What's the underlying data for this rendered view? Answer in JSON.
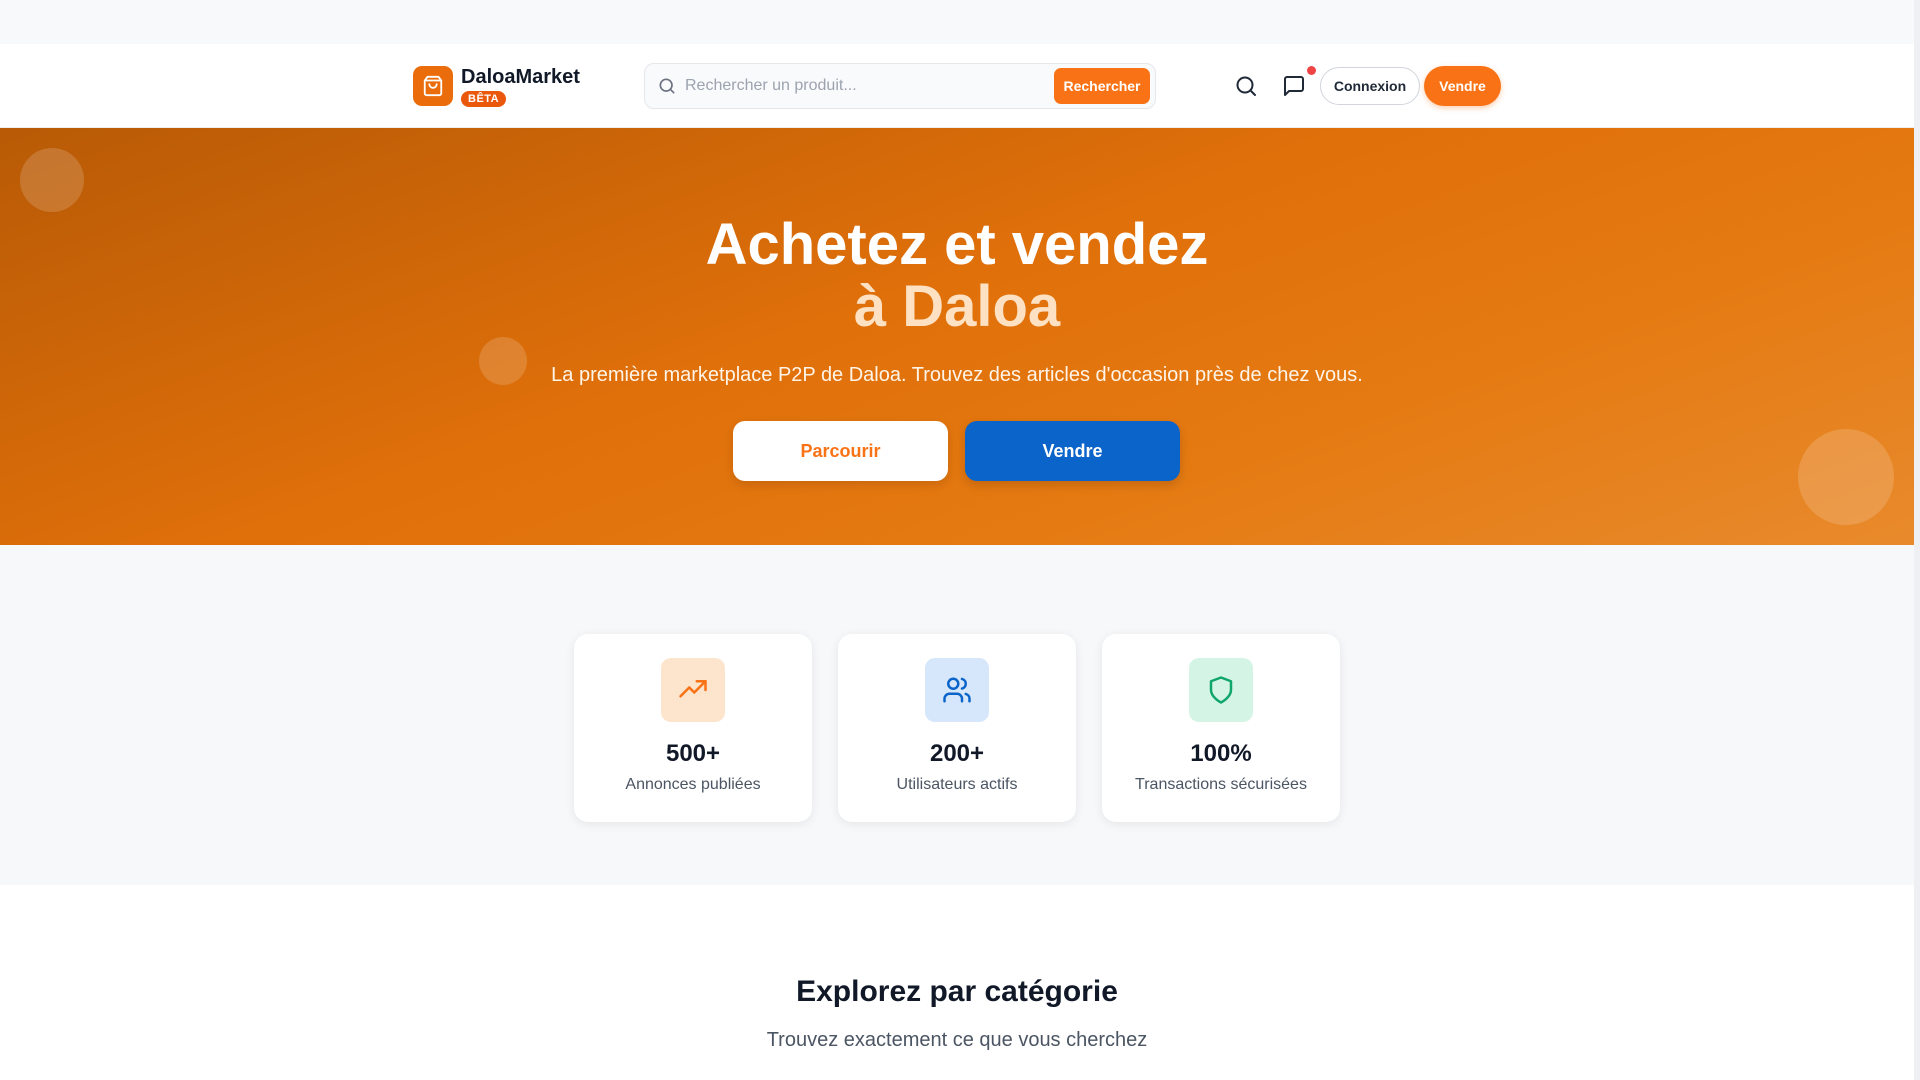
{
  "header": {
    "brand": "DaloaMarket",
    "badge": "BÊTA",
    "search_placeholder": "Rechercher un produit...",
    "search_button": "Rechercher",
    "login_label": "Connexion",
    "sell_label": "Vendre",
    "icons": [
      "shopping-bag-icon",
      "search-icon",
      "message-icon"
    ]
  },
  "hero": {
    "title_line1": "Achetez et vendez",
    "title_line2": "à Daloa",
    "subtitle": "La première marketplace P2P de Daloa. Trouvez des articles d'occasion près de chez vous.",
    "browse_label": "Parcourir",
    "sell_label": "Vendre"
  },
  "stats": [
    {
      "value": "500+",
      "label": "Annonces publiées",
      "icon": "trending-up-icon",
      "color": "#f97316",
      "bg": "#fde4cc"
    },
    {
      "value": "200+",
      "label": "Utilisateurs actifs",
      "icon": "users-icon",
      "color": "#0b64c9",
      "bg": "#d6e6fb"
    },
    {
      "value": "100%",
      "label": "Transactions sécurisées",
      "icon": "shield-icon",
      "color": "#10a56b",
      "bg": "#d4f5e6"
    }
  ],
  "categories": {
    "title": "Explorez par catégorie",
    "subtitle": "Trouvez exactement ce que vous cherchez"
  },
  "colors": {
    "accent": "#f97316",
    "secondary": "#0b64c9",
    "notification": "#ef4444"
  }
}
